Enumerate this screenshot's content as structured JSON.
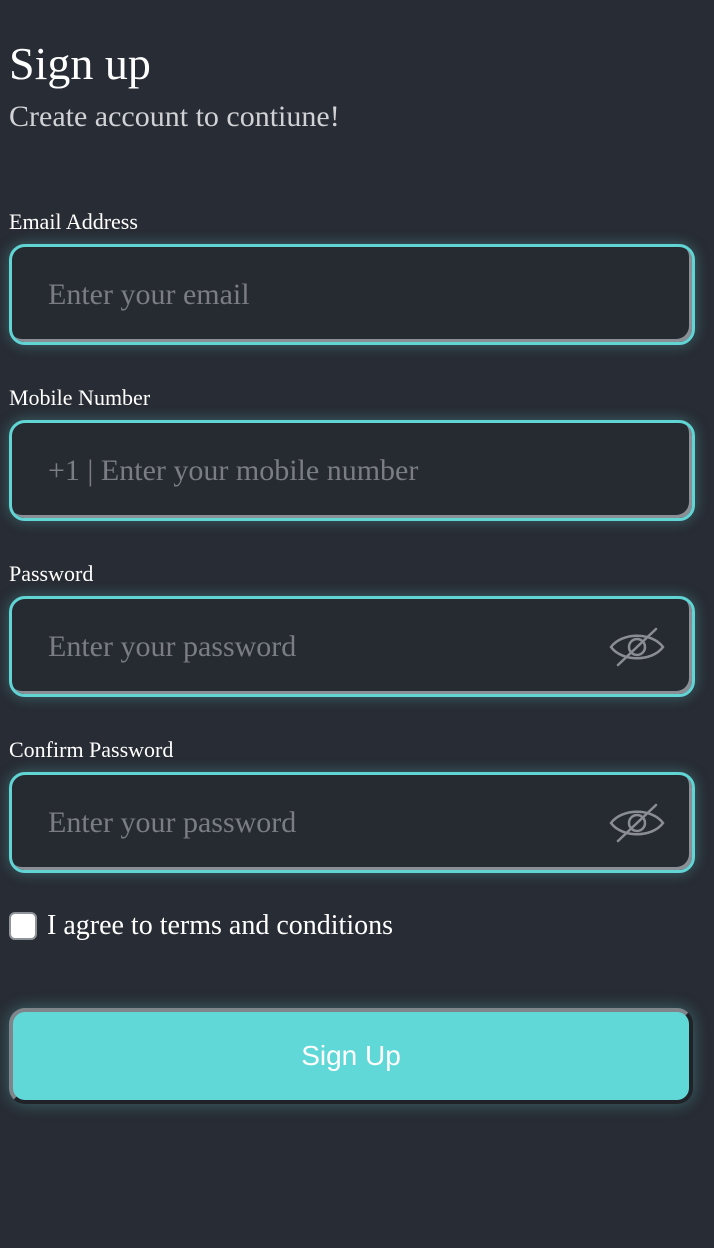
{
  "header": {
    "title": "Sign up",
    "subtitle": "Create account to contiune!"
  },
  "form": {
    "email": {
      "label": "Email Address",
      "placeholder": "Enter your email"
    },
    "mobile": {
      "label": "Mobile Number",
      "placeholder": "+1 | Enter your mobile number"
    },
    "password": {
      "label": "Password",
      "placeholder": "Enter your password",
      "toggle_icon": "eye-off-icon"
    },
    "confirm_password": {
      "label": "Confirm Password",
      "placeholder": "Enter your password",
      "toggle_icon": "eye-off-icon"
    },
    "terms": {
      "label": "I agree to terms and conditions",
      "checked": false
    },
    "submit_label": "Sign Up"
  },
  "colors": {
    "background": "#282c34",
    "accent": "#61d8d8",
    "placeholder": "#7a7e84",
    "text": "#ffffff"
  }
}
